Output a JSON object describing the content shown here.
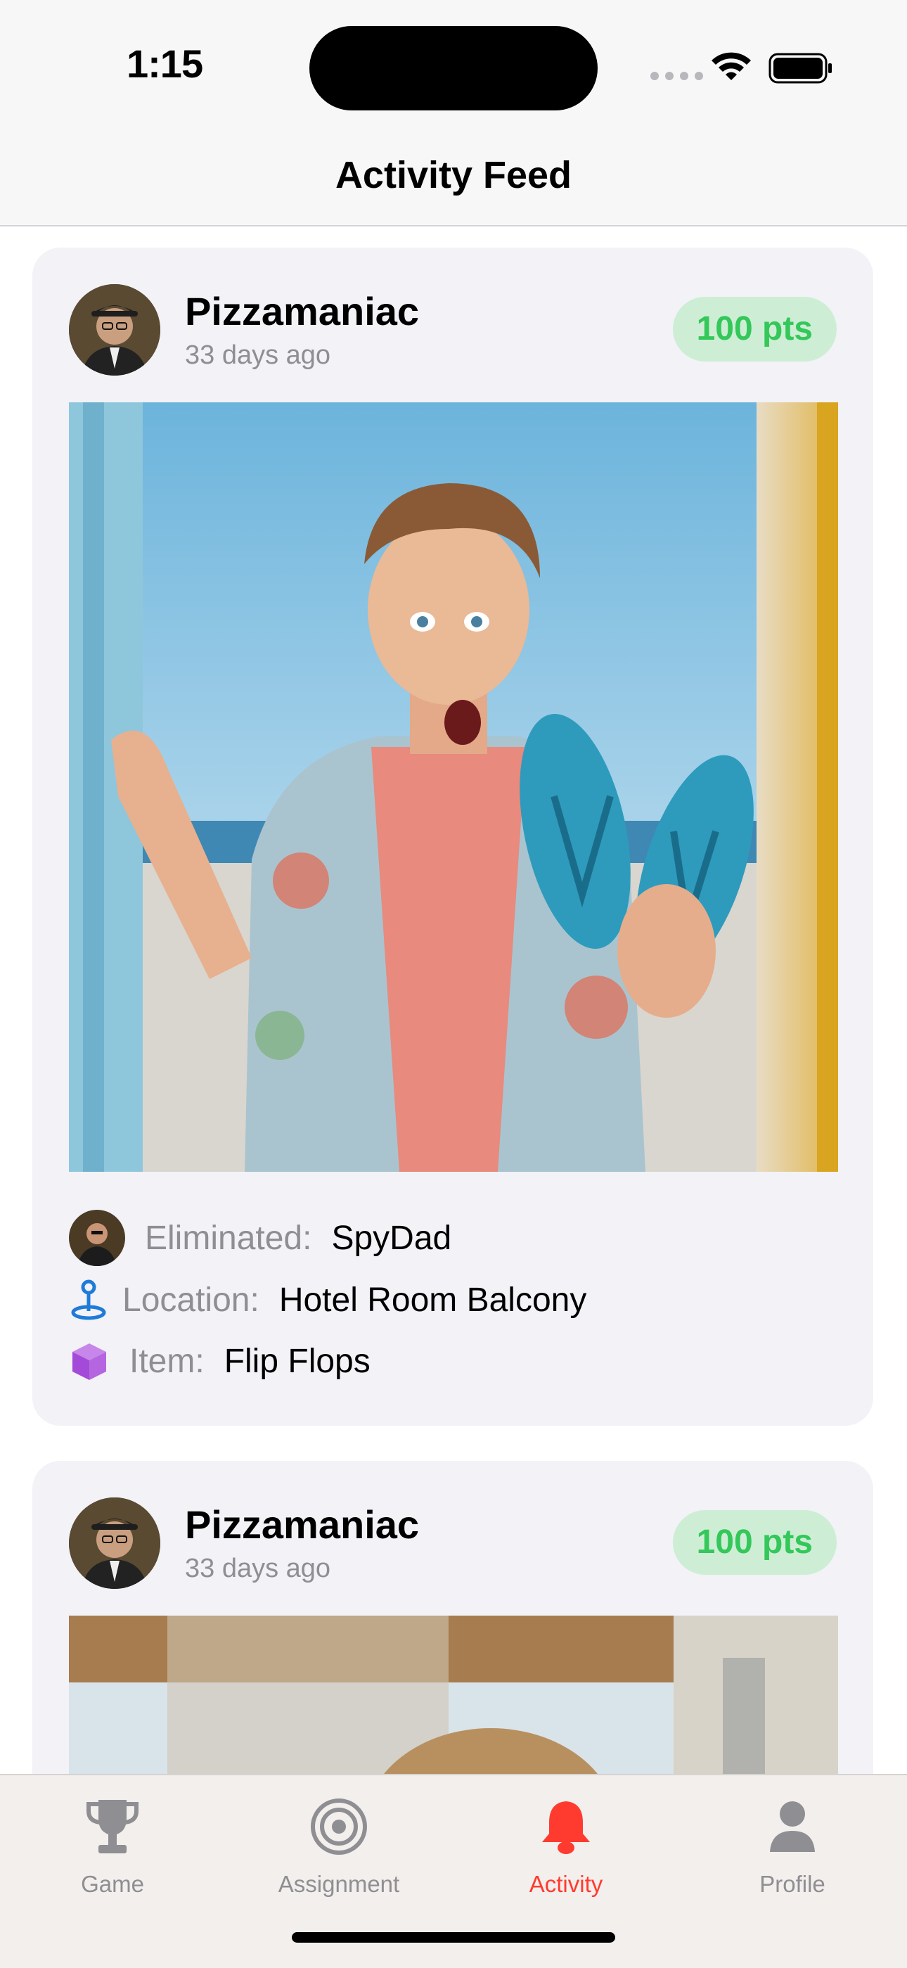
{
  "status_bar": {
    "time": "1:15"
  },
  "nav": {
    "title": "Activity Feed"
  },
  "feed": [
    {
      "username": "Pizzamaniac",
      "time_ago": "33 days ago",
      "points": "100 pts",
      "eliminated_label": "Eliminated:",
      "eliminated_value": "SpyDad",
      "location_label": "Location:",
      "location_value": "Hotel Room Balcony",
      "item_label": "Item:",
      "item_value": "Flip Flops"
    },
    {
      "username": "Pizzamaniac",
      "time_ago": "33 days ago",
      "points": "100 pts"
    }
  ],
  "tabs": [
    {
      "label": "Game",
      "icon": "trophy-icon"
    },
    {
      "label": "Assignment",
      "icon": "target-icon"
    },
    {
      "label": "Activity",
      "icon": "bell-icon",
      "active": true
    },
    {
      "label": "Profile",
      "icon": "person-icon"
    }
  ],
  "colors": {
    "accent_active": "#ff3b30",
    "points_text": "#34c759",
    "points_bg": "#cdeed5",
    "card_bg": "#f2f2f7",
    "secondary_text": "#8e8e93"
  }
}
